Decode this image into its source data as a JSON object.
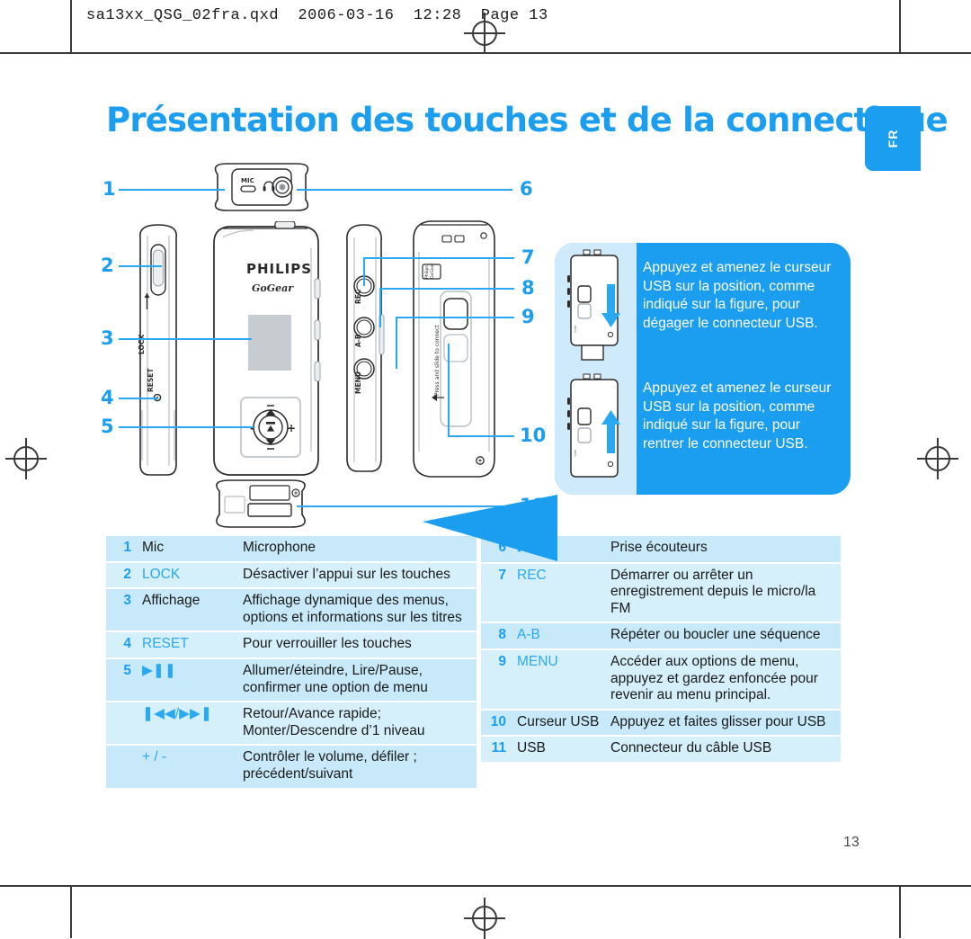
{
  "print_header": "sa13xx_QSG_02fra.qxd  2006-03-16  12:28  Page 13",
  "title": "Présentation des touches et de la connectique",
  "language_tab": "FR",
  "page_number": "13",
  "colors": {
    "accent": "#1b9df0",
    "row_light": "#d5effb",
    "row_dark": "#c8e9fa",
    "callout_bg": "#1b9df0"
  },
  "diagram": {
    "labels": [
      "1",
      "2",
      "3",
      "4",
      "5",
      "6",
      "7",
      "8",
      "9",
      "10",
      "11"
    ],
    "device_text": {
      "mic": "MIC",
      "lock": "LOCK",
      "reset": "RESET",
      "brand": "PHILIPS",
      "sub_brand": "GoGear",
      "rec": "REC",
      "ab": "A-B",
      "menu": "MENU",
      "slide_hint": "Press and slide to connect",
      "plus": "+",
      "minus": "-"
    }
  },
  "callout": {
    "release": "Appuyez et amenez le curseur USB sur la position, comme indiqué sur la figure, pour dégager le connecteur USB.",
    "retract": "Appuyez et amenez le curseur USB sur la position, comme indiqué sur la figure, pour rentrer le connecteur USB."
  },
  "legend_left": [
    {
      "num": "1",
      "key": "Mic",
      "key_color": "dark",
      "desc": "Microphone"
    },
    {
      "num": "2",
      "key": "LOCK",
      "key_color": "cyan",
      "desc": "Désactiver l’appui sur les touches"
    },
    {
      "num": "3",
      "key": "Affichage",
      "key_color": "dark",
      "desc": "Affichage dynamique des menus, options et informations sur les titres"
    },
    {
      "num": "4",
      "key": "RESET",
      "key_color": "cyan",
      "desc": "Pour verrouiller les touches"
    },
    {
      "num": "5",
      "key": "▶❚❚",
      "key_color": "cyan",
      "desc": "Allumer/éteindre, Lire/Pause, confirmer une option de menu"
    },
    {
      "num": "",
      "key": "❚◀◀/▶▶❚",
      "key_color": "cyan",
      "desc": "Retour/Avance rapide; Monter/Descendre d’1 niveau"
    },
    {
      "num": "",
      "key": "+ / -",
      "key_color": "cyan",
      "desc": "Contrôler le volume, défiler ; précédent/suivant"
    }
  ],
  "legend_right": [
    {
      "num": "6",
      "key": "Ἲ7",
      "key_color": "cyan",
      "desc": "Prise écouteurs",
      "icon": "headphones-icon"
    },
    {
      "num": "7",
      "key": "REC",
      "key_color": "cyan",
      "desc": "Démarrer ou arrêter un enregistrement depuis le micro/la FM"
    },
    {
      "num": "8",
      "key": "A-B",
      "key_color": "cyan",
      "desc": "Répéter ou boucler une séquence"
    },
    {
      "num": "9",
      "key": "MENU",
      "key_color": "cyan",
      "desc": "Accéder aux options de menu, appuyez et gardez enfoncée pour revenir au menu principal."
    },
    {
      "num": "10",
      "key": "Curseur USB",
      "key_color": "dark",
      "desc": "Appuyez et faites glisser pour USB"
    },
    {
      "num": "11",
      "key": "USB",
      "key_color": "dark",
      "desc": "Connecteur du câble USB"
    }
  ]
}
